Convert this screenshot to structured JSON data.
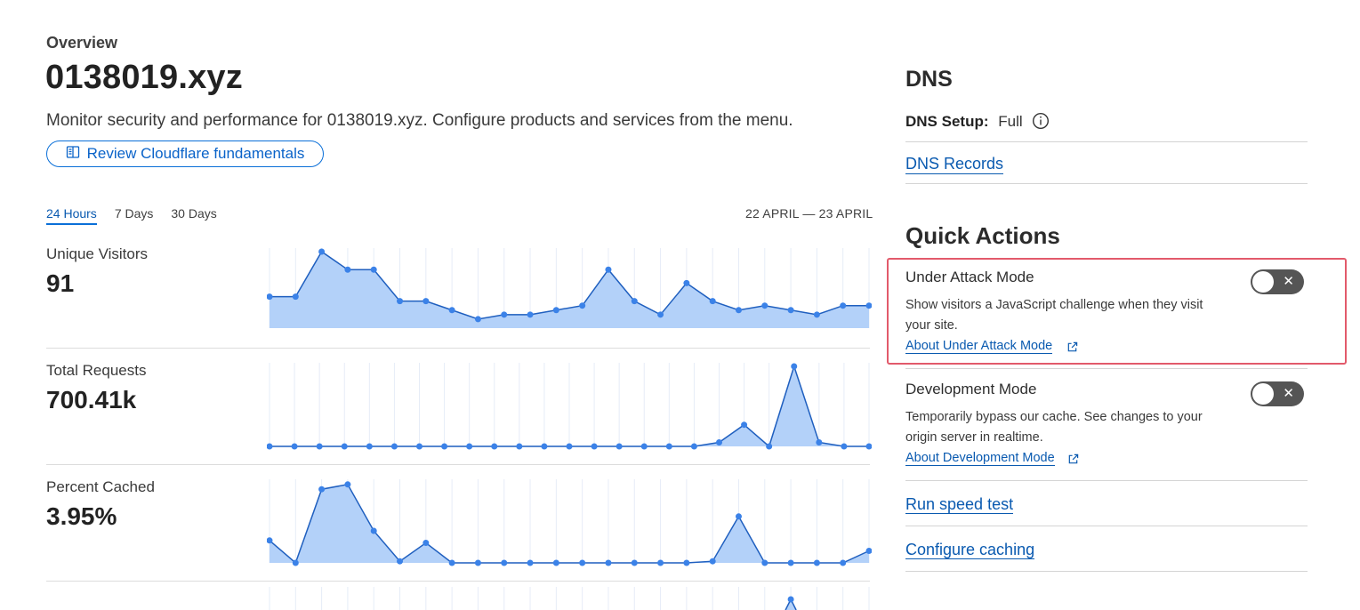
{
  "header": {
    "overview_label": "Overview",
    "zone_name": "0138019.xyz",
    "description": "Monitor security and performance for 0138019.xyz. Configure products and services from the menu.",
    "review_button_label": "Review Cloudflare fundamentals"
  },
  "range": {
    "tabs": [
      {
        "label": "24 Hours",
        "active": true
      },
      {
        "label": "7 Days",
        "active": false
      },
      {
        "label": "30 Days",
        "active": false
      }
    ],
    "date_range": "22 APRIL — 23 APRIL"
  },
  "metrics": [
    {
      "label": "Unique Visitors",
      "value": "91"
    },
    {
      "label": "Total Requests",
      "value": "700.41k"
    },
    {
      "label": "Percent Cached",
      "value": "3.95%"
    }
  ],
  "chart_data": [
    {
      "type": "area",
      "series": [
        {
          "values": [
            7,
            7,
            17,
            13,
            13,
            6,
            6,
            4,
            2,
            3,
            3,
            4,
            5,
            13,
            6,
            3,
            10,
            6,
            4,
            5,
            4,
            3,
            5,
            5
          ]
        }
      ],
      "ylim": [
        0,
        17
      ],
      "grid": true,
      "color": "#3b82e8",
      "fill": "#b3d1f9"
    },
    {
      "type": "area",
      "series": [
        {
          "values": [
            0,
            0,
            0,
            0,
            0,
            0,
            0,
            0,
            0,
            0,
            0,
            0,
            0,
            0,
            0,
            0,
            0,
            0,
            5,
            27,
            0,
            100,
            5,
            0,
            0
          ]
        }
      ],
      "ylim": [
        0,
        100
      ],
      "grid": true,
      "color": "#3b82e8",
      "fill": "#b3d1f9"
    },
    {
      "type": "area",
      "series": [
        {
          "values": [
            28,
            0,
            92,
            98,
            40,
            2,
            25,
            0,
            0,
            0,
            0,
            0,
            0,
            0,
            0,
            0,
            0,
            2,
            58,
            0,
            0,
            0,
            0,
            15
          ]
        }
      ],
      "ylim": [
        0,
        100
      ],
      "grid": true,
      "color": "#3b82e8",
      "fill": "#b3d1f9"
    }
  ],
  "dns": {
    "title": "DNS",
    "setup_key": "DNS Setup:",
    "setup_value": "Full",
    "records_link": "DNS Records"
  },
  "quick_actions": {
    "title": "Quick Actions",
    "under_attack": {
      "title": "Under Attack Mode",
      "description": "Show visitors a JavaScript challenge when they visit your site.",
      "link": "About Under Attack Mode",
      "enabled": false
    },
    "dev_mode": {
      "title": "Development Mode",
      "description": "Temporarily bypass our cache. See changes to your origin server in realtime.",
      "link": "About Development Mode",
      "enabled": false
    },
    "speed_test_link": "Run speed test",
    "caching_link": "Configure caching"
  },
  "icons": {
    "toggle_off": "✕"
  },
  "colors": {
    "accent": "#0a6fd8",
    "link": "#0a5ab0",
    "highlight": "#e25a6b",
    "toggle_off_bg": "#555555"
  }
}
